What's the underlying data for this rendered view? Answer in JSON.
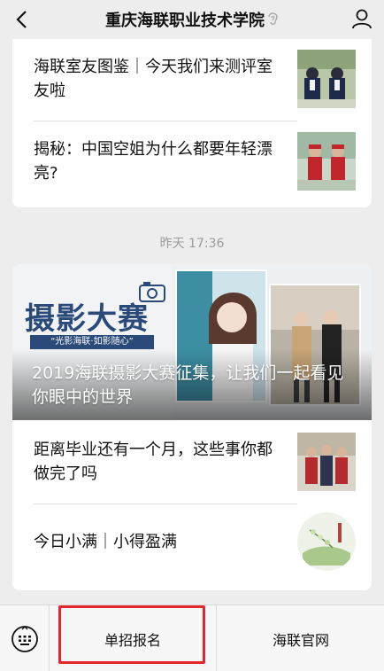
{
  "header": {
    "title": "重庆海联职业技术学院",
    "back_icon": "chevron-left-icon",
    "ear_icon": "ear-icon",
    "profile_icon": "user-icon"
  },
  "card1": {
    "items": [
      {
        "title": "海联室友图鉴｜今天我们来测评室友啦"
      },
      {
        "title": "揭秘：中国空姐为什么都要年轻漂亮?"
      }
    ]
  },
  "timestamp": "昨天 17:36",
  "card2": {
    "banner": {
      "heading": "摄影大赛",
      "slogan": "“光影海联·如影随心”",
      "caption": "2019海联摄影大赛征集，让我们一起看见你眼中的世界"
    },
    "items": [
      {
        "title": "距离毕业还有一个月，这些事你都做完了吗"
      },
      {
        "title": "今日小满｜小得盈满"
      }
    ]
  },
  "bottom_menu": {
    "keyboard_icon": "keyboard-icon",
    "items": [
      {
        "label": "单招报名"
      },
      {
        "label": "海联官网"
      }
    ]
  },
  "colors": {
    "highlight": "#e4252a",
    "banner_blue": "#2a4a7a"
  }
}
